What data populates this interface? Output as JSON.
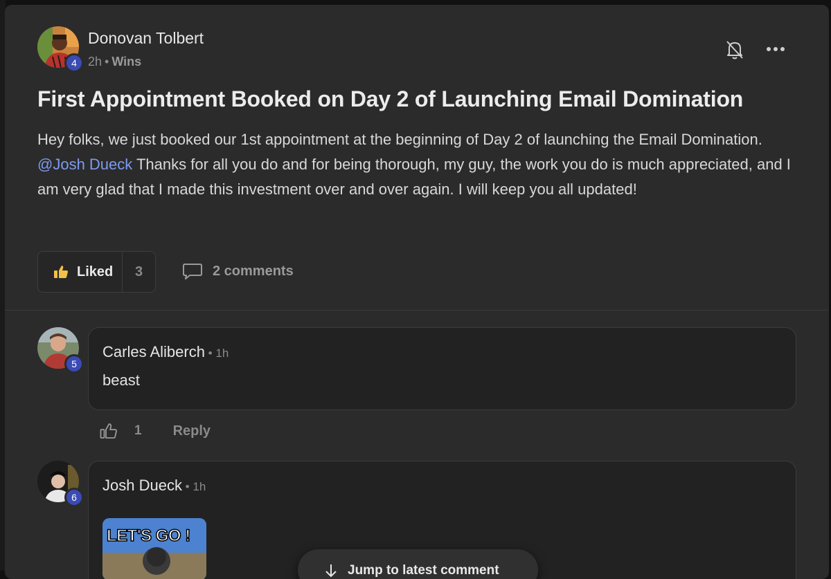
{
  "post": {
    "author": {
      "name": "Donovan Tolbert",
      "level": "4"
    },
    "time": "2h",
    "category": "Wins",
    "title": "First Appointment Booked on Day 2 of Launching Email Domination",
    "body_part1": "Hey folks, we just booked our 1st appointment at the beginning of Day 2 of launching the Email Domination. ",
    "mention": "@Josh Dueck",
    "body_part2": " Thanks for all you do and for being thorough, my guy, the work you do is much appreciated, and I am very glad that I made this investment over and over again. I will keep you all updated!",
    "like_label": "Liked",
    "like_count": "3",
    "comments_label": "2 comments"
  },
  "comments": [
    {
      "name": "Carles Aliberch",
      "time": "1h",
      "level": "5",
      "text": "beast",
      "like_count": "1",
      "reply_label": "Reply"
    },
    {
      "name": "Josh Dueck",
      "time": "1h",
      "level": "6",
      "gif_text": "LET'S GO !"
    }
  ],
  "jump_label": "Jump to latest comment",
  "colors": {
    "mention": "#7d9bf0",
    "badge": "#3b4bb5",
    "liked_icon": "#f0c04a"
  }
}
